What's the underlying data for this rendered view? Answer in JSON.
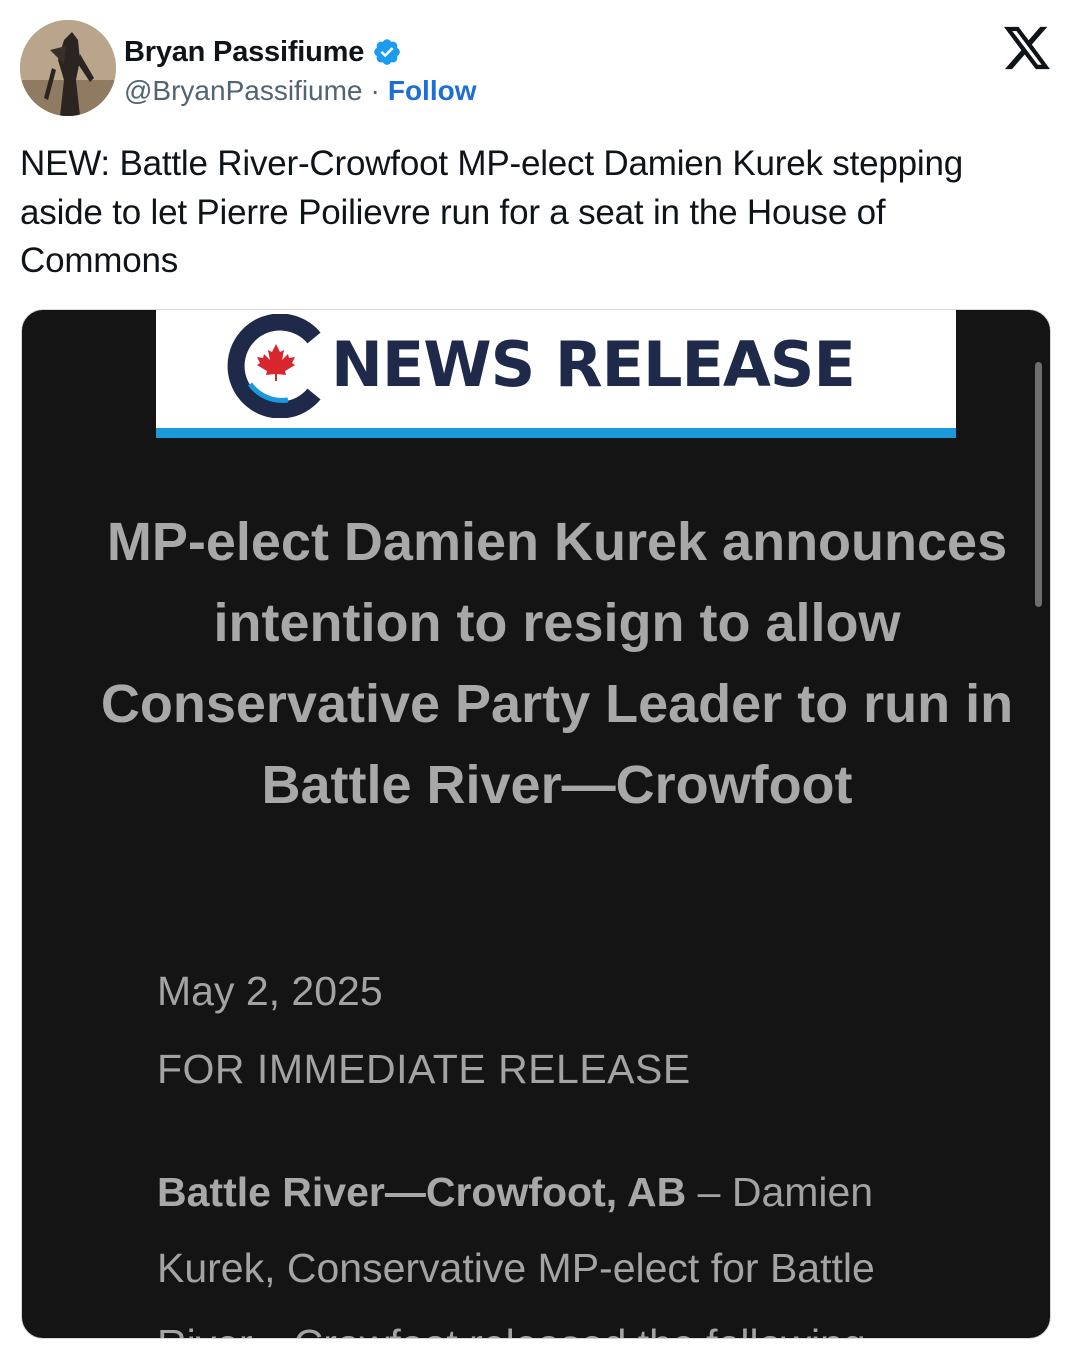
{
  "author": {
    "name": "Bryan Passifiume",
    "handle": "@BryanPassifiume",
    "separator": "·",
    "follow_label": "Follow",
    "verified": true,
    "avatar_icon": "person-silhouette-avatar"
  },
  "platform_logo": "x-logo-icon",
  "tweet": {
    "text": "NEW: Battle River-Crowfoot MP-elect Damien Kurek stepping aside to let Pierre Poilievre run for a seat in the House of Commons"
  },
  "media": {
    "banner_title": "NEWS RELEASE",
    "banner_logo": "conservative-party-maple-leaf-logo",
    "headline": "MP-elect Damien Kurek announces intention to resign to allow Conservative Party Leader to run in Battle River—Crowfoot",
    "date": "May 2, 2025",
    "status": "FOR IMMEDIATE RELEASE",
    "body_dateline": "Battle River—Crowfoot, AB",
    "body_text": " – Damien Kurek, Conservative MP-elect for Battle River—Crowfoot released the following"
  },
  "colors": {
    "follow": "#1d6fd6",
    "verified_badge": "#1d9bf0",
    "banner_stripe": "#1a9ad9",
    "banner_text": "#1f2a4a",
    "maple_leaf": "#d7262e",
    "media_background": "#141414"
  }
}
